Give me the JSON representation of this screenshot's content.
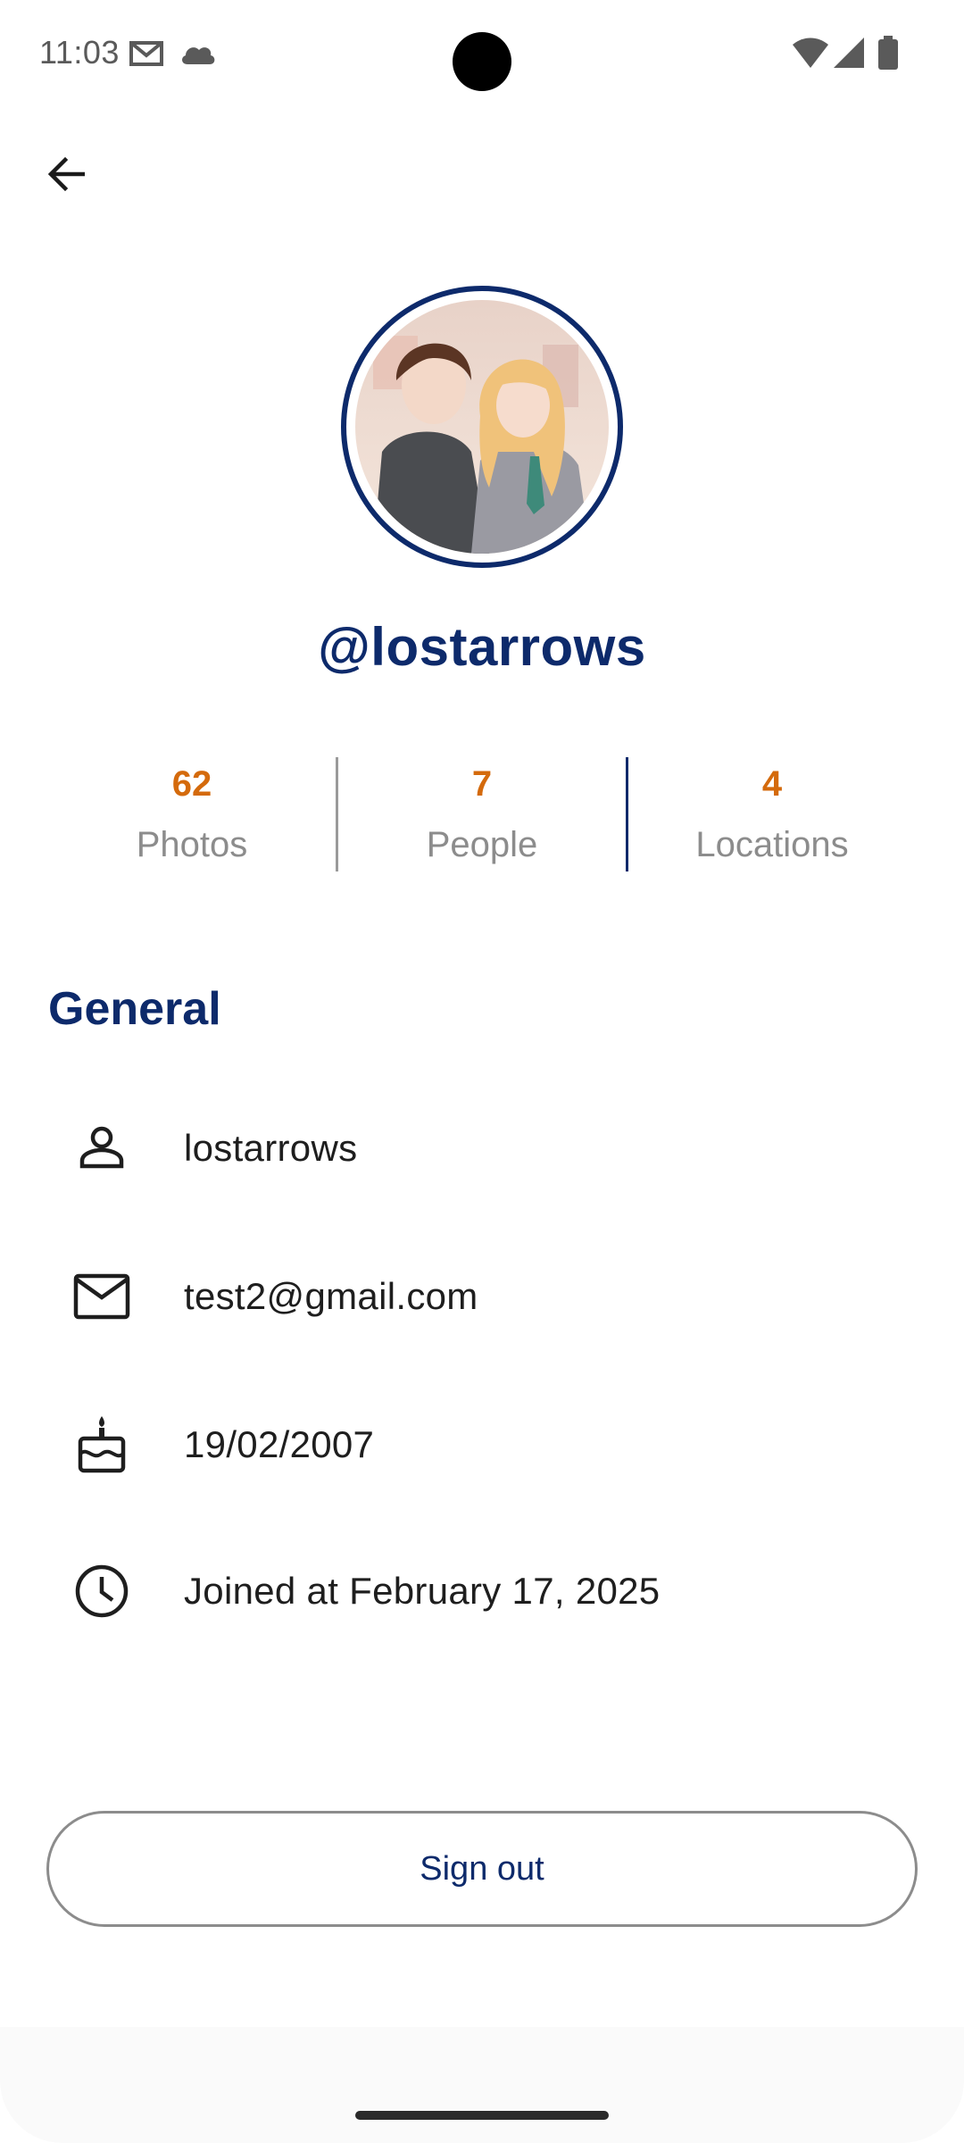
{
  "status_bar": {
    "time": "11:03",
    "icons": [
      "gmail-icon",
      "cloud-icon",
      "wifi-icon",
      "signal-icon",
      "battery-icon"
    ]
  },
  "header": {
    "back_icon": "arrow-back-icon"
  },
  "profile": {
    "handle": "@lostarrows",
    "avatar": "anime-couple-avatar"
  },
  "stats": [
    {
      "value": "62",
      "label": "Photos"
    },
    {
      "value": "7",
      "label": "People"
    },
    {
      "value": "4",
      "label": "Locations"
    }
  ],
  "general": {
    "title": "General",
    "items": [
      {
        "icon": "person-icon",
        "text": "lostarrows"
      },
      {
        "icon": "mail-icon",
        "text": "test2@gmail.com"
      },
      {
        "icon": "cake-icon",
        "text": "19/02/2007"
      },
      {
        "icon": "clock-icon",
        "text": "Joined at February 17, 2025"
      }
    ]
  },
  "actions": {
    "sign_out_label": "Sign out"
  },
  "colors": {
    "primary": "#0d2a6b",
    "accent": "#d46a0c",
    "muted": "#8c8c8c"
  }
}
